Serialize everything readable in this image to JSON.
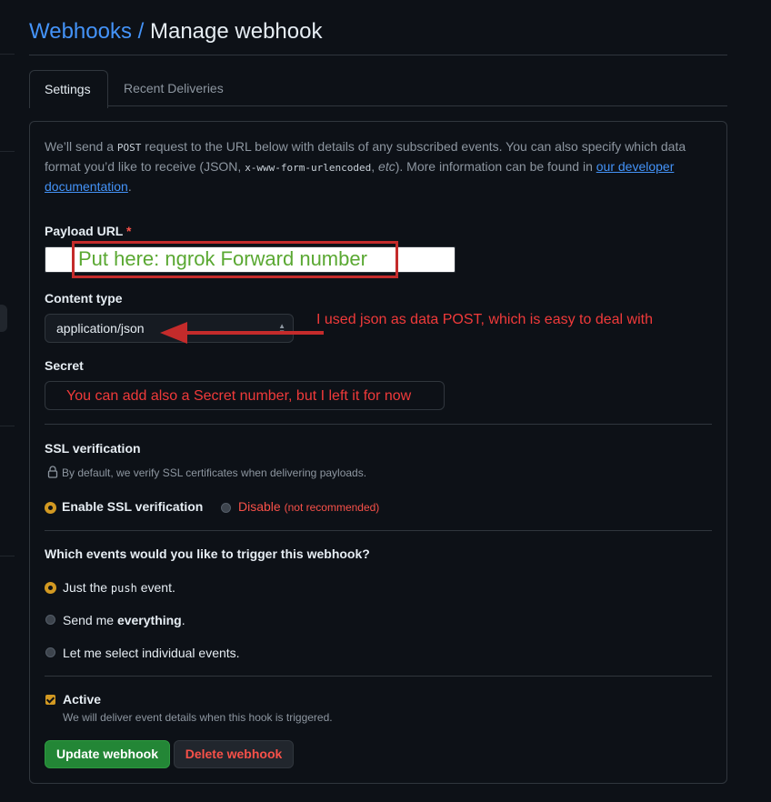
{
  "header": {
    "breadcrumb_link": "Webhooks",
    "separator": "/",
    "current": "Manage webhook"
  },
  "tabs": [
    {
      "label": "Settings",
      "active": true
    },
    {
      "label": "Recent Deliveries",
      "active": false
    }
  ],
  "intro": {
    "part1": "We’ll send a ",
    "code_post": "POST",
    "part2": " request to the URL below with details of any subscribed events. You can also specify which data format you’d like to receive (JSON, ",
    "code_form": "x-www-form-urlencoded",
    "part3": ", ",
    "etc": "etc",
    "part4": "). More information can be found in ",
    "link": "our developer documentation",
    "part5": "."
  },
  "payload": {
    "label": "Payload URL",
    "required_mark": "*",
    "annotation": "Put here: ngrok Forward number"
  },
  "content_type": {
    "label": "Content type",
    "selected": "application/json",
    "annotation": "I used json as data POST, which is easy to deal with"
  },
  "secret": {
    "label": "Secret",
    "annotation": "You can add also a Secret number, but I left it  for now"
  },
  "ssl": {
    "label": "SSL verification",
    "description": "By default, we verify SSL certificates when delivering payloads.",
    "enable_label": "Enable SSL verification",
    "disable_label": "Disable",
    "disable_note": "(not recommended)",
    "selected": "enable"
  },
  "events": {
    "question": "Which events would you like to trigger this webhook?",
    "option_push_pre": "Just the ",
    "option_push_code": "push",
    "option_push_post": " event.",
    "option_everything_pre": "Send me ",
    "option_everything_bold": "everything",
    "option_everything_post": ".",
    "option_select": "Let me select individual events.",
    "selected": "push"
  },
  "active": {
    "label": "Active",
    "checked": true,
    "description": "We will deliver event details when this hook is triggered."
  },
  "buttons": {
    "update": "Update webhook",
    "delete": "Delete webhook"
  },
  "colors": {
    "link": "#4493f8",
    "danger": "#f85149",
    "annotation_red": "#f03a3a",
    "annotation_green": "#5aa832",
    "radio_accent": "#d29922",
    "primary_button": "#238636"
  },
  "icons": [
    "lock-icon",
    "select-caret-icon",
    "annotation-arrow-icon",
    "checkbox-check-icon"
  ]
}
